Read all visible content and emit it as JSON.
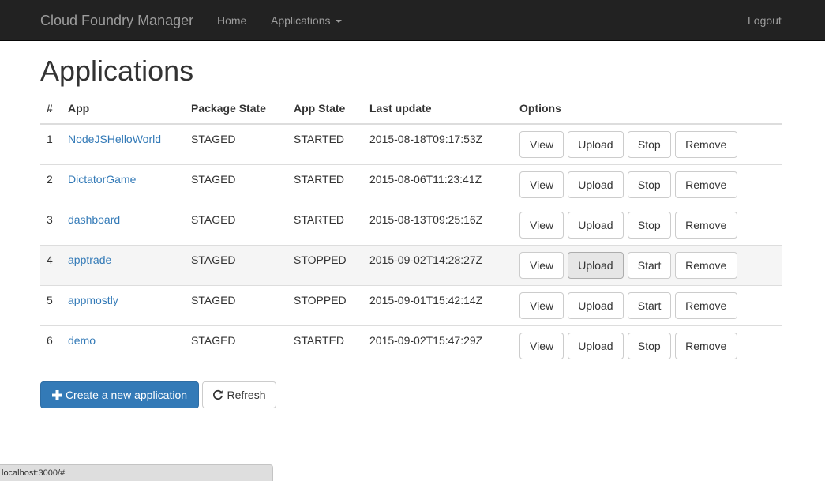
{
  "navbar": {
    "brand": "Cloud Foundry Manager",
    "home": "Home",
    "applications": "Applications",
    "logout": "Logout"
  },
  "page": {
    "title": "Applications"
  },
  "table": {
    "headers": [
      "#",
      "App",
      "Package State",
      "App State",
      "Last update",
      "Options"
    ],
    "rows": [
      {
        "num": "1",
        "app": "NodeJSHelloWorld",
        "package_state": "STAGED",
        "app_state": "STARTED",
        "last_update": "2015-08-18T09:17:53Z",
        "view": "View",
        "upload": "Upload",
        "toggle": "Stop",
        "remove": "Remove"
      },
      {
        "num": "2",
        "app": "DictatorGame",
        "package_state": "STAGED",
        "app_state": "STARTED",
        "last_update": "2015-08-06T11:23:41Z",
        "view": "View",
        "upload": "Upload",
        "toggle": "Stop",
        "remove": "Remove"
      },
      {
        "num": "3",
        "app": "dashboard",
        "package_state": "STAGED",
        "app_state": "STARTED",
        "last_update": "2015-08-13T09:25:16Z",
        "view": "View",
        "upload": "Upload",
        "toggle": "Stop",
        "remove": "Remove"
      },
      {
        "num": "4",
        "app": "apptrade",
        "package_state": "STAGED",
        "app_state": "STOPPED",
        "last_update": "2015-09-02T14:28:27Z",
        "view": "View",
        "upload": "Upload",
        "toggle": "Start",
        "remove": "Remove"
      },
      {
        "num": "5",
        "app": "appmostly",
        "package_state": "STAGED",
        "app_state": "STOPPED",
        "last_update": "2015-09-01T15:42:14Z",
        "view": "View",
        "upload": "Upload",
        "toggle": "Start",
        "remove": "Remove"
      },
      {
        "num": "6",
        "app": "demo",
        "package_state": "STAGED",
        "app_state": "STARTED",
        "last_update": "2015-09-02T15:47:29Z",
        "view": "View",
        "upload": "Upload",
        "toggle": "Stop",
        "remove": "Remove"
      }
    ]
  },
  "actions": {
    "create": "Create a new application",
    "refresh": "Refresh"
  },
  "status_bar": {
    "url": "localhost:3000/#"
  },
  "colors": {
    "navbar_bg": "#222222",
    "link": "#337ab7",
    "primary": "#337ab7"
  },
  "icons": {
    "create": "plus-icon",
    "refresh": "refresh-icon",
    "dropdown": "caret-down-icon"
  }
}
